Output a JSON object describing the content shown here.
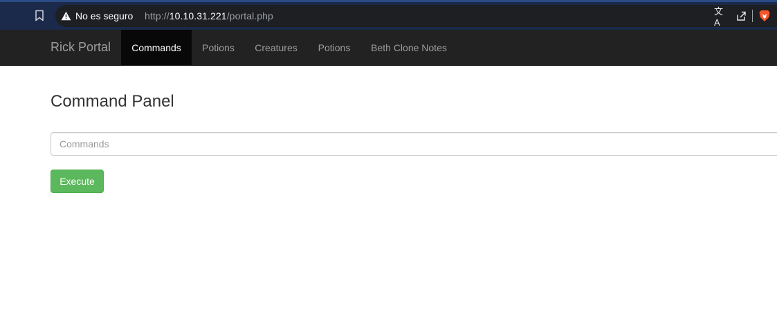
{
  "browser": {
    "security_label": "No es seguro",
    "url_scheme": "http://",
    "url_host": "10.10.31.221",
    "url_path": "/portal.php",
    "translate_glyph": "文A",
    "accent_color": "#2b4b86"
  },
  "navbar": {
    "brand": "Rick Portal",
    "items": [
      {
        "label": "Commands",
        "active": true
      },
      {
        "label": "Potions",
        "active": false
      },
      {
        "label": "Creatures",
        "active": false
      },
      {
        "label": "Potions",
        "active": false
      },
      {
        "label": "Beth Clone Notes",
        "active": false
      }
    ]
  },
  "main": {
    "title": "Command Panel",
    "input_placeholder": "Commands",
    "input_value": "",
    "execute_label": "Execute",
    "button_color": "#5cb85c"
  },
  "icons": {
    "bookmark": "bookmark-icon",
    "warning": "warning-icon",
    "translate": "translate-icon",
    "share": "share-icon",
    "brave": "brave-lion-icon"
  }
}
